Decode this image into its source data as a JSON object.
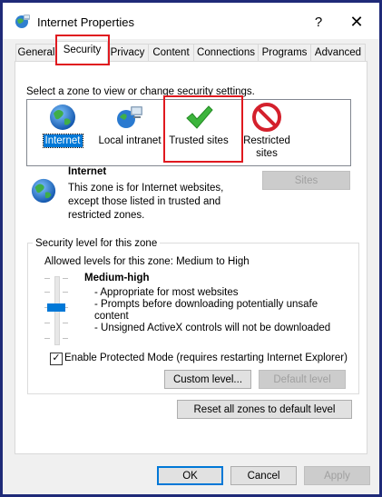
{
  "window": {
    "title": "Internet Properties",
    "help_label": "?",
    "close_label": "✕"
  },
  "tabs": [
    {
      "label": "General"
    },
    {
      "label": "Security"
    },
    {
      "label": "Privacy"
    },
    {
      "label": "Content"
    },
    {
      "label": "Connections"
    },
    {
      "label": "Programs"
    },
    {
      "label": "Advanced"
    }
  ],
  "security": {
    "instruction": "Select a zone to view or change security settings.",
    "zones": [
      {
        "label": "Internet",
        "icon": "globe-icon",
        "selected": true
      },
      {
        "label": "Local intranet",
        "icon": "network-computers-icon"
      },
      {
        "label": "Trusted sites",
        "icon": "green-checkmark-icon"
      },
      {
        "label": "Restricted sites",
        "icon": "no-entry-icon"
      }
    ],
    "zone_info": {
      "title": "Internet",
      "description": "This zone is for Internet websites, except those listed in trusted and restricted zones."
    },
    "sites_button": "Sites",
    "level_group": {
      "label": "Security level for this zone",
      "allowed": "Allowed levels for this zone: Medium to High",
      "level_name": "Medium-high",
      "bullets": [
        "- Appropriate for most websites",
        "- Prompts before downloading potentially unsafe content",
        "- Unsigned ActiveX controls will not be downloaded"
      ],
      "protected_mode_label": "Enable Protected Mode (requires restarting Internet Explorer)",
      "protected_mode_checked": true,
      "custom_level_button": "Custom level...",
      "default_level_button": "Default level"
    },
    "reset_button": "Reset all zones to default level"
  },
  "footer": {
    "ok": "OK",
    "cancel": "Cancel",
    "apply": "Apply"
  },
  "colors": {
    "highlight_red": "#e0191f",
    "selection_blue": "#0078d7",
    "frame_blue": "#1f2a78"
  }
}
